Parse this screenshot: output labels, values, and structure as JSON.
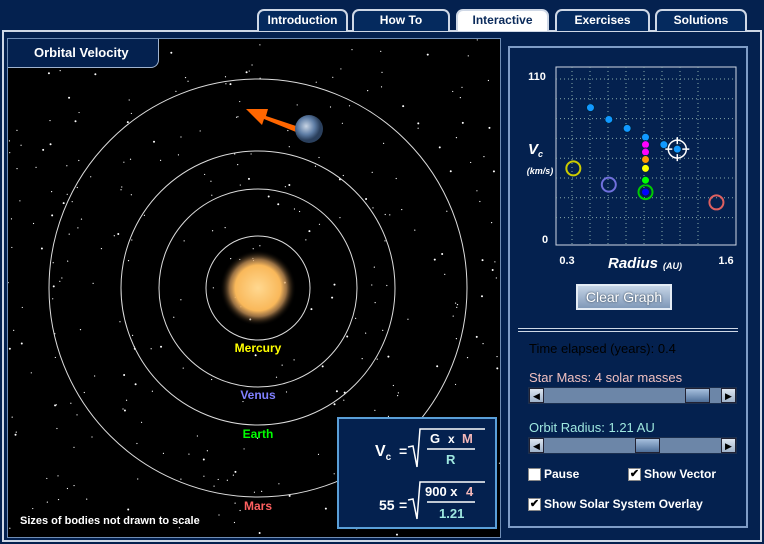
{
  "tabs": [
    {
      "label": "Introduction"
    },
    {
      "label": "How To"
    },
    {
      "label": "Interactive",
      "active": true
    },
    {
      "label": "Exercises"
    },
    {
      "label": "Solutions"
    }
  ],
  "sim": {
    "title": "Orbital Velocity",
    "note": "Sizes of bodies not drawn to scale",
    "planets": [
      {
        "name": "Mercury",
        "color": "#ffff00"
      },
      {
        "name": "Venus",
        "color": "#8080ff"
      },
      {
        "name": "Earth",
        "color": "#00ff00"
      },
      {
        "name": "Mars",
        "color": "#ff6060"
      }
    ],
    "vector_color": "#ff6600"
  },
  "formula": {
    "lhs": "V",
    "sub": "c",
    "eq": "=",
    "G": "G",
    "x": "x",
    "M": "M",
    "R": "R",
    "value": "55",
    "g_value": "900 x",
    "m_value": "4",
    "r_value": "1.21"
  },
  "chart_data": {
    "type": "scatter",
    "ylabel": "V",
    "ylabel_sub": "c",
    "yunit": "(km/s)",
    "xlabel": "Radius",
    "xunit": "(AU)",
    "xlim": [
      0.3,
      1.6
    ],
    "ylim": [
      0,
      110
    ],
    "xticks": [
      "0.3",
      "1.6"
    ],
    "yticks": [
      "110",
      "0"
    ],
    "grid": true,
    "history": [
      {
        "x": 0.5,
        "y": 88
      },
      {
        "x": 0.65,
        "y": 80
      },
      {
        "x": 0.8,
        "y": 74
      },
      {
        "x": 0.95,
        "y": 68
      },
      {
        "x": 1.1,
        "y": 63
      },
      {
        "x": 1.21,
        "y": 60
      }
    ],
    "mass_series": [
      {
        "x": 0.95,
        "y": 63,
        "color": "#ff00ff"
      },
      {
        "x": 0.95,
        "y": 58,
        "color": "#ff00ff"
      },
      {
        "x": 0.95,
        "y": 53,
        "color": "#ff9900"
      },
      {
        "x": 0.95,
        "y": 47,
        "color": "#ffff00"
      },
      {
        "x": 0.95,
        "y": 39,
        "color": "#00ff00"
      },
      {
        "x": 0.95,
        "y": 31,
        "color": "#0000ff"
      }
    ],
    "planets": [
      {
        "name": "Mercury",
        "x": 0.36,
        "y": 47,
        "color": "#cccc00"
      },
      {
        "name": "Venus",
        "x": 0.65,
        "y": 36,
        "color": "#7070dd"
      },
      {
        "name": "Earth",
        "x": 0.95,
        "y": 31,
        "color": "#00cc00"
      },
      {
        "name": "Mars",
        "x": 1.53,
        "y": 24,
        "color": "#dd6060"
      }
    ],
    "current": {
      "x": 1.21,
      "y": 60
    }
  },
  "panel": {
    "clear_label": "Clear Graph",
    "time": "Time elapsed (years): 0.4",
    "mass_label": "Star Mass: 4 solar masses",
    "mass_fraction": 0.93,
    "radius_label": "Orbit Radius: 1.21 AU",
    "radius_fraction": 0.6,
    "pause": {
      "label": "Pause",
      "checked": false
    },
    "vector": {
      "label": "Show Vector",
      "checked": true
    },
    "overlay": {
      "label": "Show Solar System Overlay",
      "checked": true
    },
    "mass_color": "#f0c0c0",
    "radius_color": "#9fe8e0"
  }
}
